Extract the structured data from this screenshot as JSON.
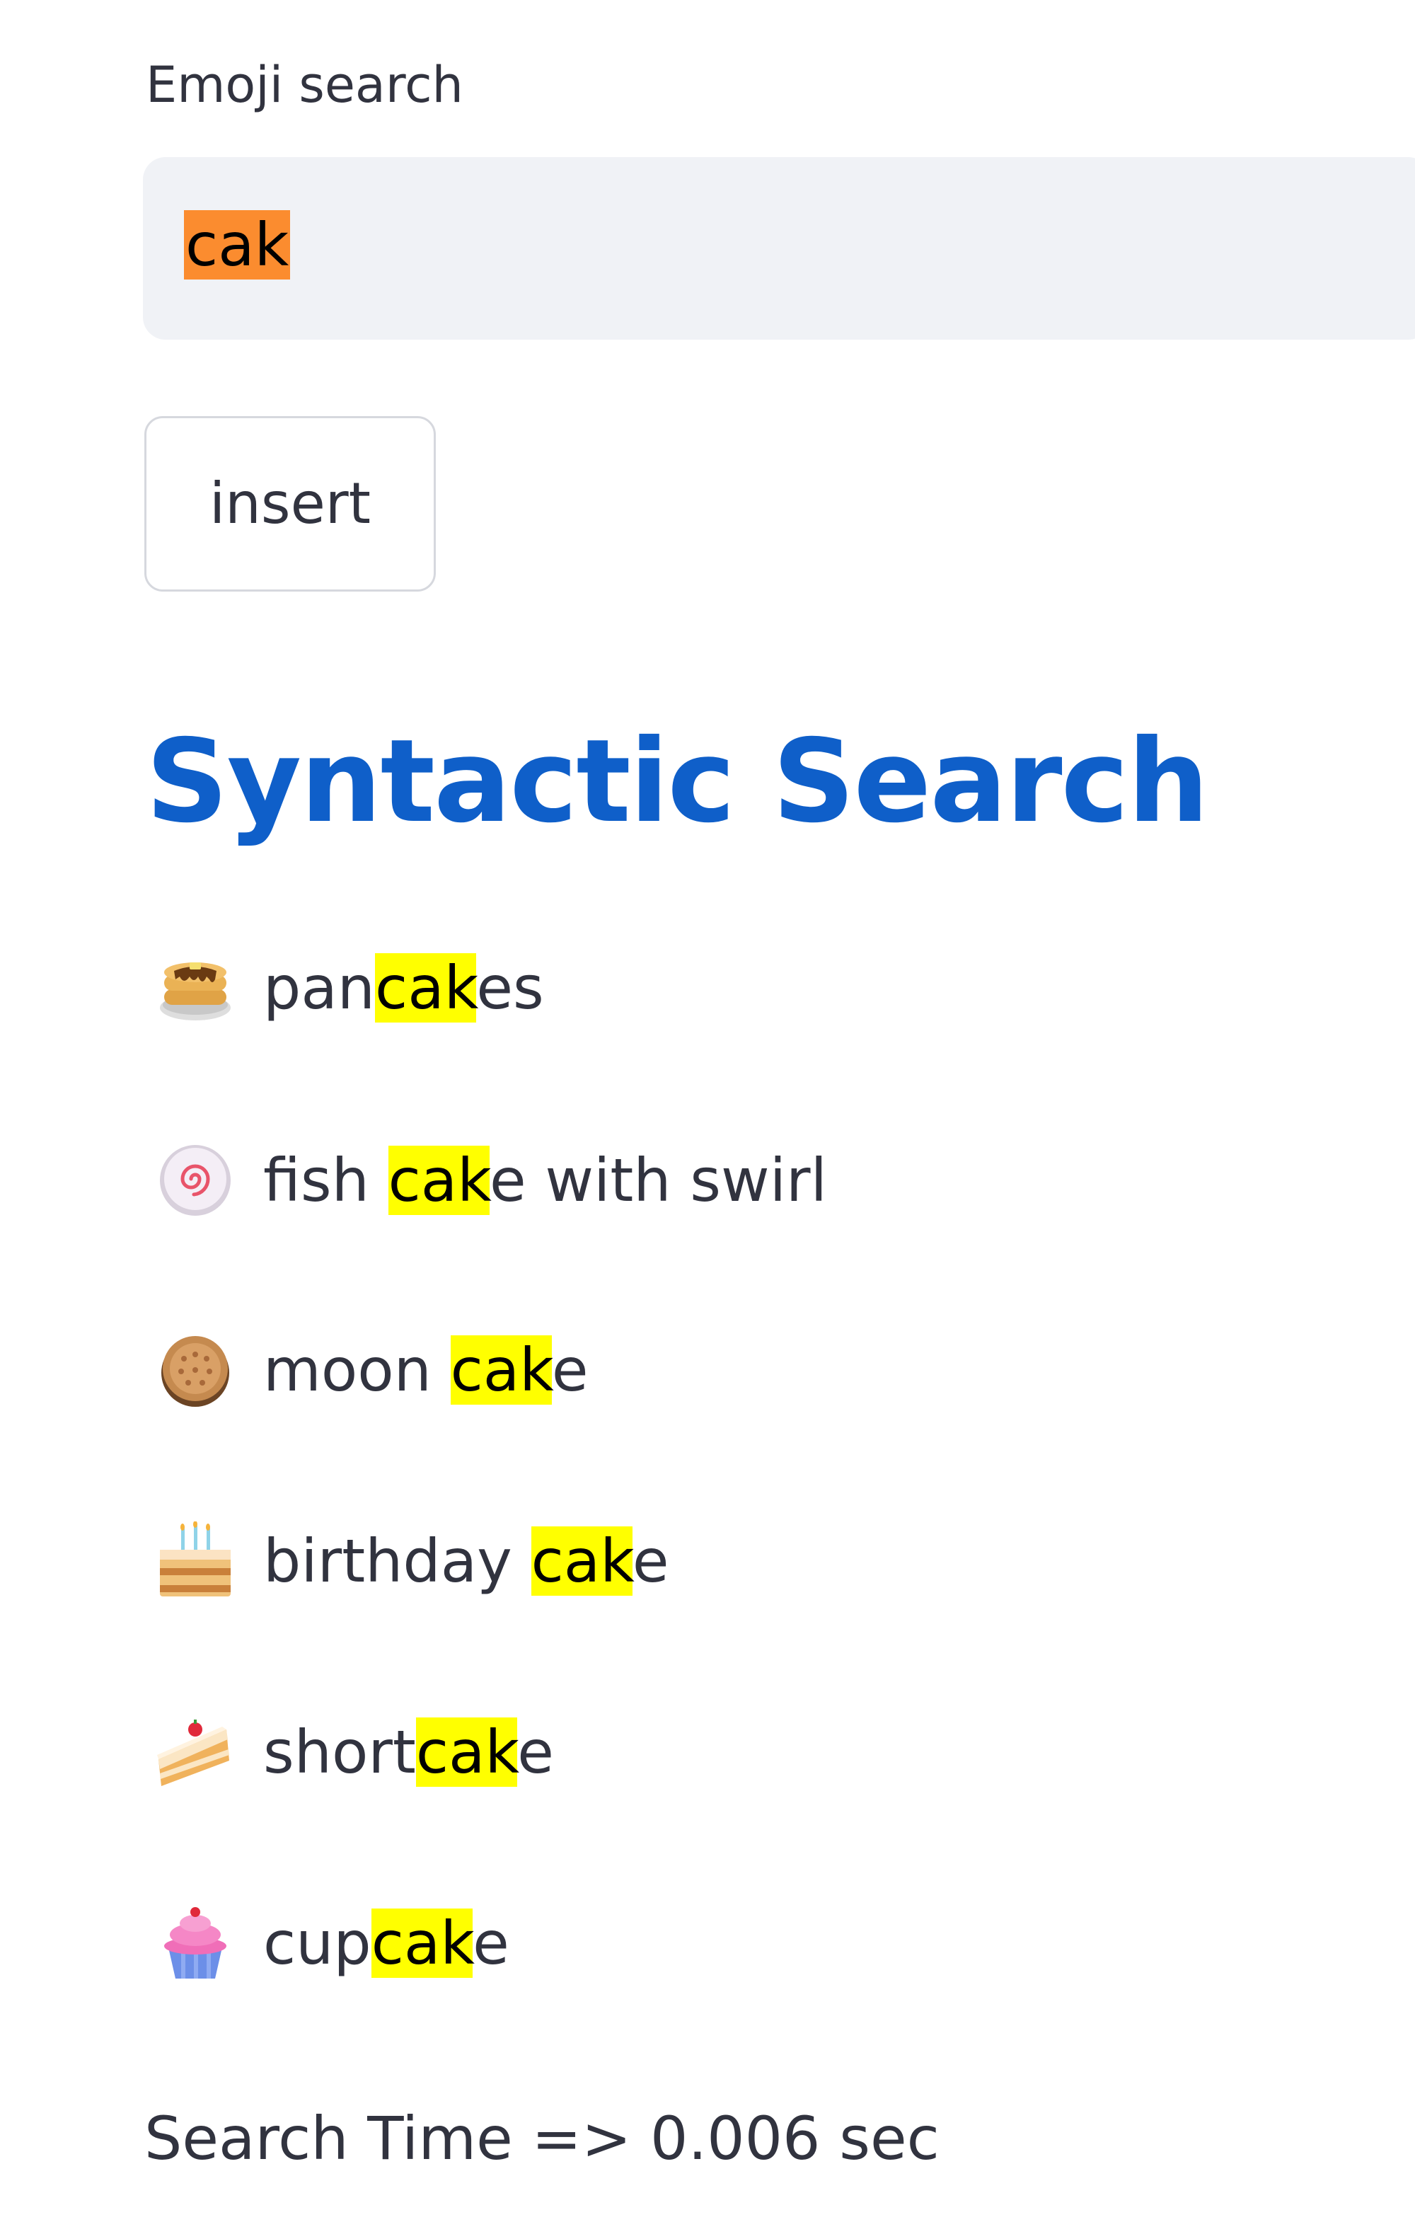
{
  "search_field": {
    "label": "Emoji search",
    "value": "cak",
    "selection_color": "#fb8c2f"
  },
  "insert_button": {
    "label": "insert"
  },
  "section": {
    "title": "Syntactic Search",
    "title_color": "#0f5fc9"
  },
  "highlight_color": "#ffff00",
  "results": [
    {
      "icon": "pancakes-icon",
      "before": "pan",
      "match": "cak",
      "after": "es"
    },
    {
      "icon": "fish-cake-with-swirl-icon",
      "before": "fish ",
      "match": "cak",
      "after": "e with swirl"
    },
    {
      "icon": "moon-cake-icon",
      "before": "moon ",
      "match": "cak",
      "after": "e"
    },
    {
      "icon": "birthday-cake-icon",
      "before": "birthday ",
      "match": "cak",
      "after": "e"
    },
    {
      "icon": "shortcake-icon",
      "before": "short",
      "match": "cak",
      "after": "e"
    },
    {
      "icon": "cupcake-icon",
      "before": "cup",
      "match": "cak",
      "after": "e"
    }
  ],
  "search_time": "Search Time => 0.006 sec"
}
